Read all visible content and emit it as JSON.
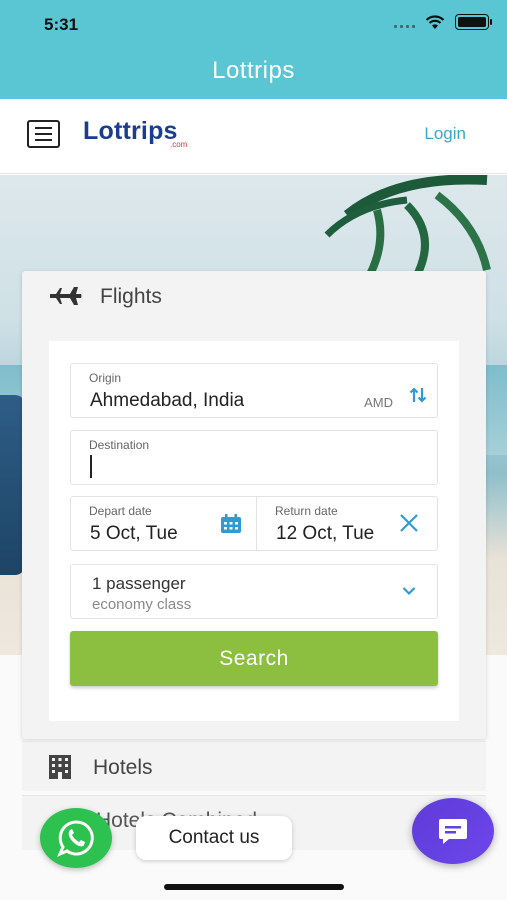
{
  "status_bar": {
    "time": "5:31"
  },
  "app_title": "Lottrips",
  "header": {
    "menu_icon": "hamburger-menu-icon",
    "logo": "Lottrips",
    "logo_suffix": ".com",
    "login_label": "Login"
  },
  "flights_tab": {
    "icon": "airplane-icon",
    "label": "Flights",
    "origin": {
      "label": "Origin",
      "value": "Ahmedabad, India",
      "code": "AMD",
      "swap_icon": "swap-vertical-icon"
    },
    "destination": {
      "label": "Destination",
      "value": ""
    },
    "depart": {
      "label": "Depart date",
      "value": "5 Oct, Tue",
      "icon": "calendar-icon"
    },
    "return": {
      "label": "Return date",
      "value": "12 Oct, Tue",
      "clear_icon": "close-icon"
    },
    "passengers": {
      "line1": "1 passenger",
      "line2": "economy class",
      "icon": "chevron-down-icon"
    },
    "search_label": "Search"
  },
  "hotels_tab": {
    "icon": "building-icon",
    "label": "Hotels"
  },
  "combined_tab": {
    "label": "Hotels Combined"
  },
  "contact": {
    "whatsapp_icon": "whatsapp-icon",
    "label": "Contact us"
  },
  "chat": {
    "icon": "chat-bubble-icon"
  },
  "colors": {
    "appbar": "#5ac6d3",
    "search_button": "#8cbf3f",
    "accent": "#3aa8c9",
    "chat_button": "#6242e0",
    "whatsapp": "#2dc150"
  }
}
